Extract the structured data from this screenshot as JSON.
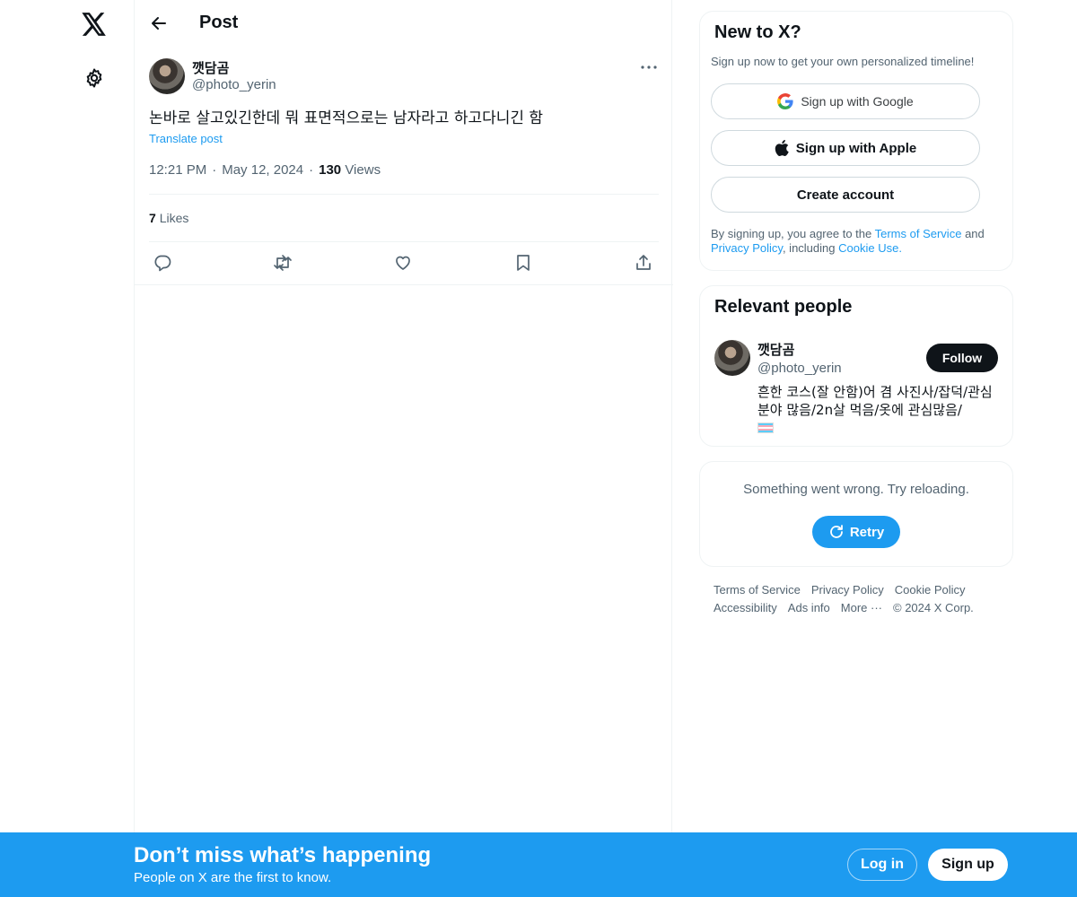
{
  "nav": {
    "logo_icon": "x-logo-icon",
    "settings_icon": "gear-icon"
  },
  "header": {
    "back_icon": "arrow-left-icon",
    "title": "Post"
  },
  "post": {
    "author_name": "깻담곰",
    "author_handle": "@photo_yerin",
    "text": "논바로 살고있긴한데 뭐 표면적으로는 남자라고 하고다니긴 함",
    "translate_label": "Translate post",
    "time": "12:21 PM",
    "date": "May 12, 2024",
    "views_count": "130",
    "views_label": "Views",
    "likes_count": "7",
    "likes_label": "Likes",
    "actions": [
      "reply-icon",
      "repost-icon",
      "like-icon",
      "bookmark-icon",
      "share-icon"
    ]
  },
  "signup_card": {
    "title": "New to X?",
    "subtitle": "Sign up now to get your own personalized timeline!",
    "google_label": "Sign up with Google",
    "apple_label": "Sign up with Apple",
    "create_label": "Create account",
    "legal_prefix": "By signing up, you agree to the",
    "terms_link": "Terms of Service",
    "legal_and": "and",
    "privacy_link": "Privacy Policy",
    "legal_including": ", including",
    "cookie_link": "Cookie Use."
  },
  "relevant_people": {
    "title": "Relevant people",
    "name": "깻담곰",
    "handle": "@photo_yerin",
    "follow_label": "Follow",
    "bio": "흔한 코스(잘 안함)어 겸 사진사/잡덕/관심분야 많음/2n살 먹음/옷에 관심많음/"
  },
  "error_card": {
    "message": "Something went wrong. Try reloading.",
    "retry_label": "Retry"
  },
  "footer": {
    "links": [
      "Terms of Service",
      "Privacy Policy",
      "Cookie Policy",
      "Accessibility",
      "Ads info",
      "More ···"
    ],
    "copyright": "© 2024 X Corp."
  },
  "banner": {
    "title": "Don’t miss what’s happening",
    "subtitle": "People on X are the first to know.",
    "login_label": "Log in",
    "signup_label": "Sign up"
  },
  "colors": {
    "accent": "#1d9bf0",
    "text_primary": "#0f1419",
    "text_secondary": "#536471",
    "border": "#eff3f4"
  }
}
